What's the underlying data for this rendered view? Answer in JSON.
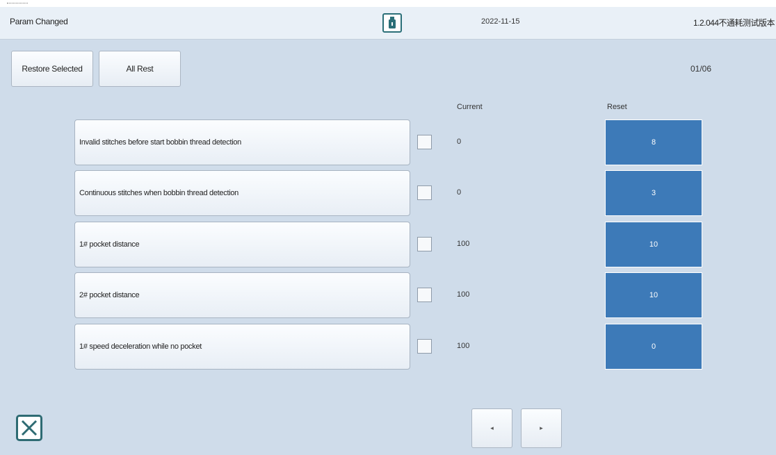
{
  "header": {
    "title": "Param Changed",
    "date": "2022-11-15",
    "version": "1.2.044不通耗测试版本",
    "usb_icon": "usb-drive-icon"
  },
  "toolbar": {
    "restore_selected_label": "Restore Selected",
    "all_reset_label": "All Rest",
    "page_indicator": "01/06"
  },
  "columns": {
    "current_label": "Current",
    "reset_label": "Reset"
  },
  "params": [
    {
      "name": "Invalid stitches before start bobbin thread detection",
      "checked": false,
      "current": "0",
      "reset": "8"
    },
    {
      "name": "Continuous stitches when bobbin thread detection",
      "checked": false,
      "current": "0",
      "reset": "3"
    },
    {
      "name": "1# pocket distance",
      "checked": false,
      "current": "100",
      "reset": "10"
    },
    {
      "name": "2# pocket distance",
      "checked": false,
      "current": "100",
      "reset": "10"
    },
    {
      "name": "1# speed deceleration while no pocket",
      "checked": false,
      "current": "100",
      "reset": "0"
    }
  ],
  "footer": {
    "close_icon": "close-icon",
    "prev_icon": "◂",
    "next_icon": "▸"
  },
  "colors": {
    "background": "#cfdcea",
    "reset_cell": "#3d7ab8",
    "icon_accent": "#2e6b73"
  }
}
